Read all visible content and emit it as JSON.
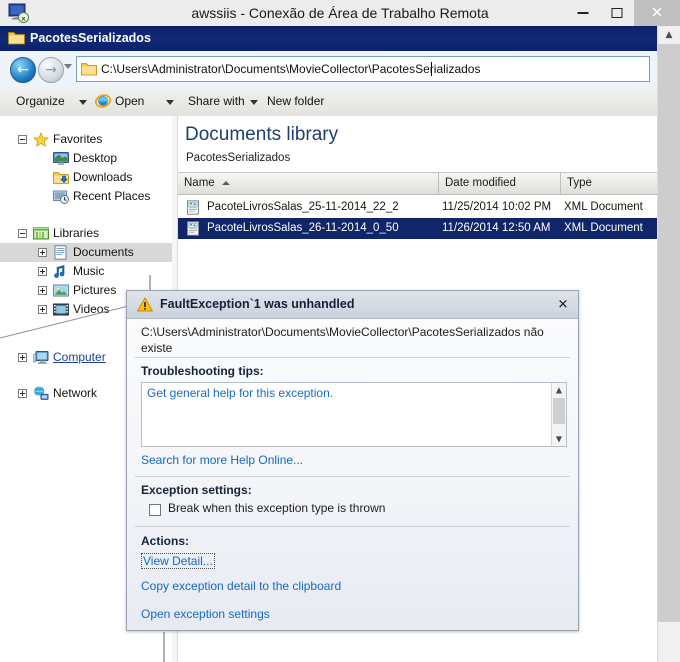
{
  "rdp": {
    "title": "awssiis - Conexão de Área de Trabalho Remota",
    "app_icon": "remote-desktop-icon",
    "minimize_label": "–",
    "maximize_label": "",
    "close_label": "✕"
  },
  "explorer": {
    "window_title": "PacotesSerializados",
    "address": {
      "path": "C:\\Users\\Administrator\\Documents\\MovieCollector\\PacotesSerializados",
      "back_arrow": "←",
      "forward_arrow": "→"
    },
    "toolbar": [
      {
        "label": "Organize",
        "caret": true,
        "icon": null
      },
      {
        "label": "Open",
        "caret": true,
        "icon": "internet-explorer-icon"
      },
      {
        "label": "Share with",
        "caret": true,
        "icon": null
      },
      {
        "label": "New folder",
        "caret": false,
        "icon": null
      }
    ],
    "nav_pane": {
      "groups": [
        {
          "header": {
            "label": "Favorites",
            "icon": "star-icon",
            "expander": "minus"
          },
          "items": [
            {
              "label": "Desktop",
              "icon": "desktop-icon"
            },
            {
              "label": "Downloads",
              "icon": "downloads-folder-icon"
            },
            {
              "label": "Recent Places",
              "icon": "recent-places-icon"
            }
          ]
        },
        {
          "header": {
            "label": "Libraries",
            "icon": "libraries-icon",
            "expander": "minus"
          },
          "items": [
            {
              "label": "Documents",
              "icon": "documents-library-icon",
              "expander": "plus",
              "selected": true
            },
            {
              "label": "Music",
              "icon": "music-library-icon",
              "expander": "plus",
              "selected": false
            },
            {
              "label": "Pictures",
              "icon": "pictures-library-icon",
              "expander": "plus",
              "selected": false
            },
            {
              "label": "Videos",
              "icon": "videos-library-icon",
              "expander": "plus",
              "selected": false
            }
          ]
        },
        {
          "header": {
            "label": "Computer",
            "icon": "computer-icon",
            "expander": "plus",
            "link": true
          },
          "items": []
        },
        {
          "header": {
            "label": "Network",
            "icon": "network-icon",
            "expander": "plus"
          },
          "items": []
        }
      ]
    },
    "content": {
      "library_title": "Documents library",
      "library_subtitle": "PacotesSerializados",
      "columns": [
        {
          "label": "Name",
          "sorted": true
        },
        {
          "label": "Date modified",
          "sorted": false
        },
        {
          "label": "Type",
          "sorted": false
        }
      ],
      "rows": [
        {
          "name": "PacoteLivrosSalas_25-11-2014_22_2",
          "date_modified": "11/25/2014 10:02 PM",
          "type": "XML Document",
          "icon": "xml-document-icon",
          "selected": false
        },
        {
          "name": "PacoteLivrosSalas_26-11-2014_0_50",
          "date_modified": "11/26/2014 12:50 AM",
          "type": "XML Document",
          "icon": "xml-document-icon",
          "selected": true
        }
      ]
    }
  },
  "exception_dialog": {
    "icon": "warning-triangle-icon",
    "title": "FaultException`1 was unhandled",
    "close_label": "✕",
    "message": "C:\\Users\\Administrator\\Documents\\MovieCollector\\PacotesSerializados não existe",
    "troubleshooting_label": "Troubleshooting tips:",
    "troubleshooting_tips": "Get general help for this exception.",
    "search_online_label": "Search for more Help Online...",
    "exception_settings_label": "Exception settings:",
    "break_checkbox_label": "Break when this exception type is thrown",
    "break_checkbox_checked": false,
    "actions_label": "Actions:",
    "action_view_detail": "View Detail...",
    "action_copy_detail": "Copy exception detail to the clipboard",
    "action_open_settings": "Open exception settings",
    "scroll_up": "▲",
    "scroll_down": "▼"
  },
  "colors": {
    "explorer_titlebar": "#102a72",
    "selection": "#10256a",
    "link": "#1569c7",
    "library_title": "#1f3f6e",
    "warning": "#ffc20e"
  }
}
